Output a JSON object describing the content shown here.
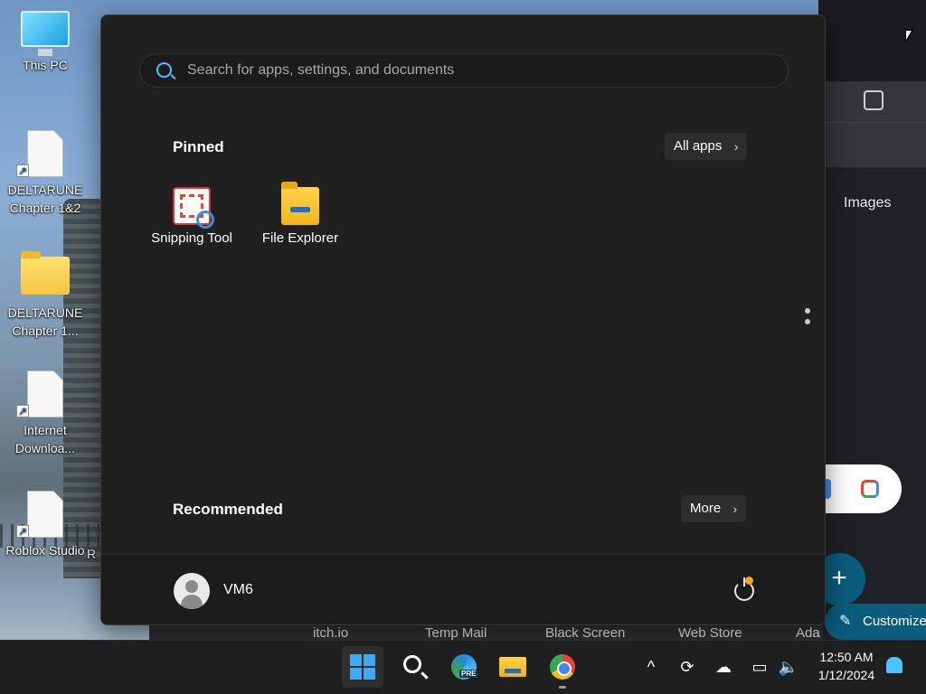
{
  "desktop": {
    "icons": [
      {
        "label": "This PC",
        "icon": "monitor-icon"
      },
      {
        "label": "DELTARUNE Chapter 1&2",
        "icon": "document-shortcut-icon"
      },
      {
        "label": "DELTARUNE Chapter 1...",
        "icon": "folder-icon"
      },
      {
        "label": "Internet Downloa...",
        "icon": "document-shortcut-icon"
      },
      {
        "label": "Roblox Studio",
        "icon": "document-shortcut-icon"
      }
    ],
    "partial_label": "R"
  },
  "start_menu": {
    "search": {
      "placeholder": "Search for apps, settings, and documents",
      "value": ""
    },
    "pinned": {
      "title": "Pinned",
      "all_apps_label": "All apps",
      "apps": [
        {
          "label": "Snipping Tool",
          "icon": "snipping-tool-icon"
        },
        {
          "label": "File Explorer",
          "icon": "file-explorer-icon"
        }
      ]
    },
    "recommended": {
      "title": "Recommended",
      "more_label": "More"
    },
    "user": {
      "name": "VM6"
    },
    "chevron_glyph": "›"
  },
  "browser": {
    "images_link": "Images",
    "fab_glyph": "+",
    "customize_label": "Customize",
    "bookmarks": [
      "itch.io",
      "Temp Mail",
      "Black Screen",
      "Web Store",
      "Ada"
    ]
  },
  "taskbar": {
    "apps": [
      "start-icon",
      "search-icon",
      "edge-preview-icon",
      "file-explorer-icon",
      "chrome-icon"
    ],
    "clock": {
      "time": "12:50 AM",
      "date": "1/12/2024"
    },
    "tray": {
      "chevron": "^"
    }
  },
  "colors": {
    "accent": "#4cc2ff",
    "menu_bg": "#202020",
    "taskbar_bg": "#1f1f1f",
    "browser_accent": "#0b5c7d"
  }
}
